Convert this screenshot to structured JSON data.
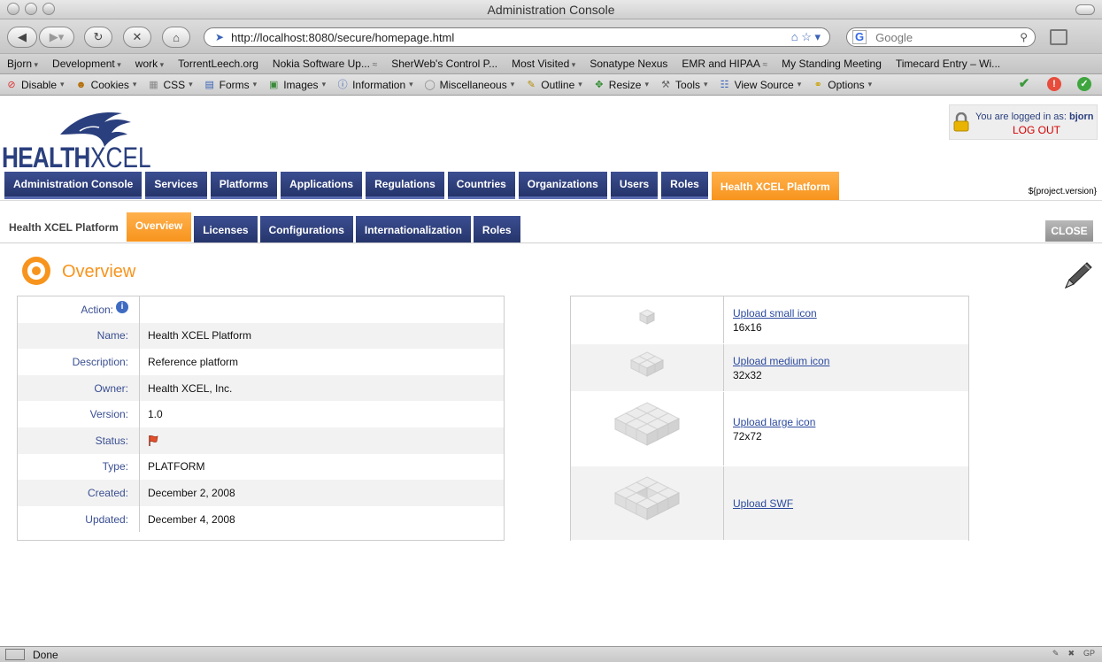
{
  "window": {
    "title": "Administration Console"
  },
  "browser": {
    "url": "http://localhost:8080/secure/homepage.html",
    "search_placeholder": "Google",
    "bookmarks": [
      {
        "label": "Bjorn",
        "kind": "dd"
      },
      {
        "label": "Development",
        "kind": "dd"
      },
      {
        "label": "work",
        "kind": "dd"
      },
      {
        "label": "TorrentLeech.org",
        "kind": ""
      },
      {
        "label": "Nokia Software Up...",
        "kind": "rss"
      },
      {
        "label": "SherWeb's Control P...",
        "kind": ""
      },
      {
        "label": "Most Visited",
        "kind": "dd"
      },
      {
        "label": "Sonatype Nexus",
        "kind": ""
      },
      {
        "label": "EMR and HIPAA",
        "kind": "rss"
      },
      {
        "label": "My Standing Meeting",
        "kind": ""
      },
      {
        "label": "Timecard Entry – Wi...",
        "kind": ""
      }
    ],
    "devtools": [
      {
        "label": "Disable",
        "icon": "disable-icon"
      },
      {
        "label": "Cookies",
        "icon": "cookies-icon"
      },
      {
        "label": "CSS",
        "icon": "css-icon"
      },
      {
        "label": "Forms",
        "icon": "forms-icon"
      },
      {
        "label": "Images",
        "icon": "images-icon"
      },
      {
        "label": "Information",
        "icon": "information-icon"
      },
      {
        "label": "Miscellaneous",
        "icon": "miscellaneous-icon"
      },
      {
        "label": "Outline",
        "icon": "outline-icon"
      },
      {
        "label": "Resize",
        "icon": "resize-icon"
      },
      {
        "label": "Tools",
        "icon": "tools-icon"
      },
      {
        "label": "View Source",
        "icon": "view-source-icon"
      },
      {
        "label": "Options",
        "icon": "options-icon"
      }
    ],
    "status": "Done"
  },
  "header": {
    "logo_health": "HEALTH",
    "logo_xcel": "XCEL",
    "logged_in_label": "You are logged in as:",
    "username": "bjorn",
    "logout": "LOG OUT",
    "version": "${project.version}"
  },
  "main_tabs": [
    "Administration Console",
    "Services",
    "Platforms",
    "Applications",
    "Regulations",
    "Countries",
    "Organizations",
    "Users",
    "Roles",
    "Health XCEL Platform"
  ],
  "main_tabs_active": 9,
  "sub": {
    "label": "Health XCEL Platform",
    "tabs": [
      "Overview",
      "Licenses",
      "Configurations",
      "Internationalization",
      "Roles"
    ],
    "active": 0,
    "close": "CLOSE"
  },
  "overview": {
    "title": "Overview",
    "rows": [
      {
        "label": "Action:",
        "value": "",
        "special": "info"
      },
      {
        "label": "Name:",
        "value": "Health XCEL Platform"
      },
      {
        "label": "Description:",
        "value": "Reference platform"
      },
      {
        "label": "Owner:",
        "value": "Health XCEL, Inc."
      },
      {
        "label": "Version:",
        "value": "1.0"
      },
      {
        "label": "Status:",
        "value": "",
        "special": "flag"
      },
      {
        "label": "Type:",
        "value": "PLATFORM"
      },
      {
        "label": "Created:",
        "value": "December 2, 2008"
      },
      {
        "label": "Updated:",
        "value": "December 4, 2008"
      }
    ],
    "uploads": [
      {
        "link": "Upload small icon",
        "size": "16x16",
        "grid": 1
      },
      {
        "link": "Upload medium icon",
        "size": "32x32",
        "grid": 2
      },
      {
        "link": "Upload large icon",
        "size": "72x72",
        "grid": 3
      },
      {
        "link": "Upload SWF",
        "size": "",
        "grid": 3
      }
    ]
  },
  "colors": {
    "navy": "#2a3f7e",
    "orange": "#f7941d",
    "link": "#2b4a9e",
    "red": "#d40000"
  }
}
